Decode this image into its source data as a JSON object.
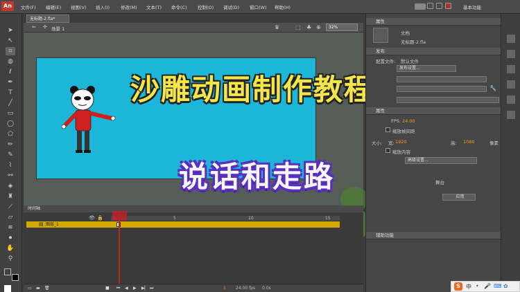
{
  "app": {
    "logo": "An",
    "workspace": "基本功能"
  },
  "menu": [
    "文件(F)",
    "编辑(E)",
    "视图(V)",
    "插入(I)",
    "修改(M)",
    "文本(T)",
    "命令(C)",
    "控制(O)",
    "调试(D)",
    "窗口(W)",
    "帮助(H)"
  ],
  "document": {
    "tab": "无标题-2.fla*",
    "scene": "场景 1",
    "zoom": "32%"
  },
  "titles": {
    "main": "沙雕动画制作教程",
    "sub": "说话和走路"
  },
  "panel": {
    "tab": "属性",
    "doc_label": "文档",
    "doc_name": "无标题-2.fla",
    "publish_header": "发布",
    "config_label": "配置文件:",
    "config_value": "默认文件",
    "publish_settings": "发布设置...",
    "props_header": "属性",
    "fps_label": "FPS:",
    "fps_value": "24.00",
    "scale_frames": "缩放帧间距",
    "size_label": "大小:",
    "width_label": "宽:",
    "width_value": "1920",
    "height_label": "高:",
    "height_value": "1080",
    "unit": "像素",
    "scale_content": "缩放内容",
    "advanced": "高级设置...",
    "stage_label": "舞台",
    "apply": "应用",
    "assist_header": "辅助功能"
  },
  "timeline": {
    "header": "时间轴",
    "layer": "图层_1",
    "ticks": [
      "1",
      "5",
      "10",
      "15"
    ],
    "current_frame": "1",
    "fps_readout": "24.00 fps",
    "time": "0.0s"
  },
  "taskbar": {
    "s_icon": "S",
    "text": "中"
  }
}
